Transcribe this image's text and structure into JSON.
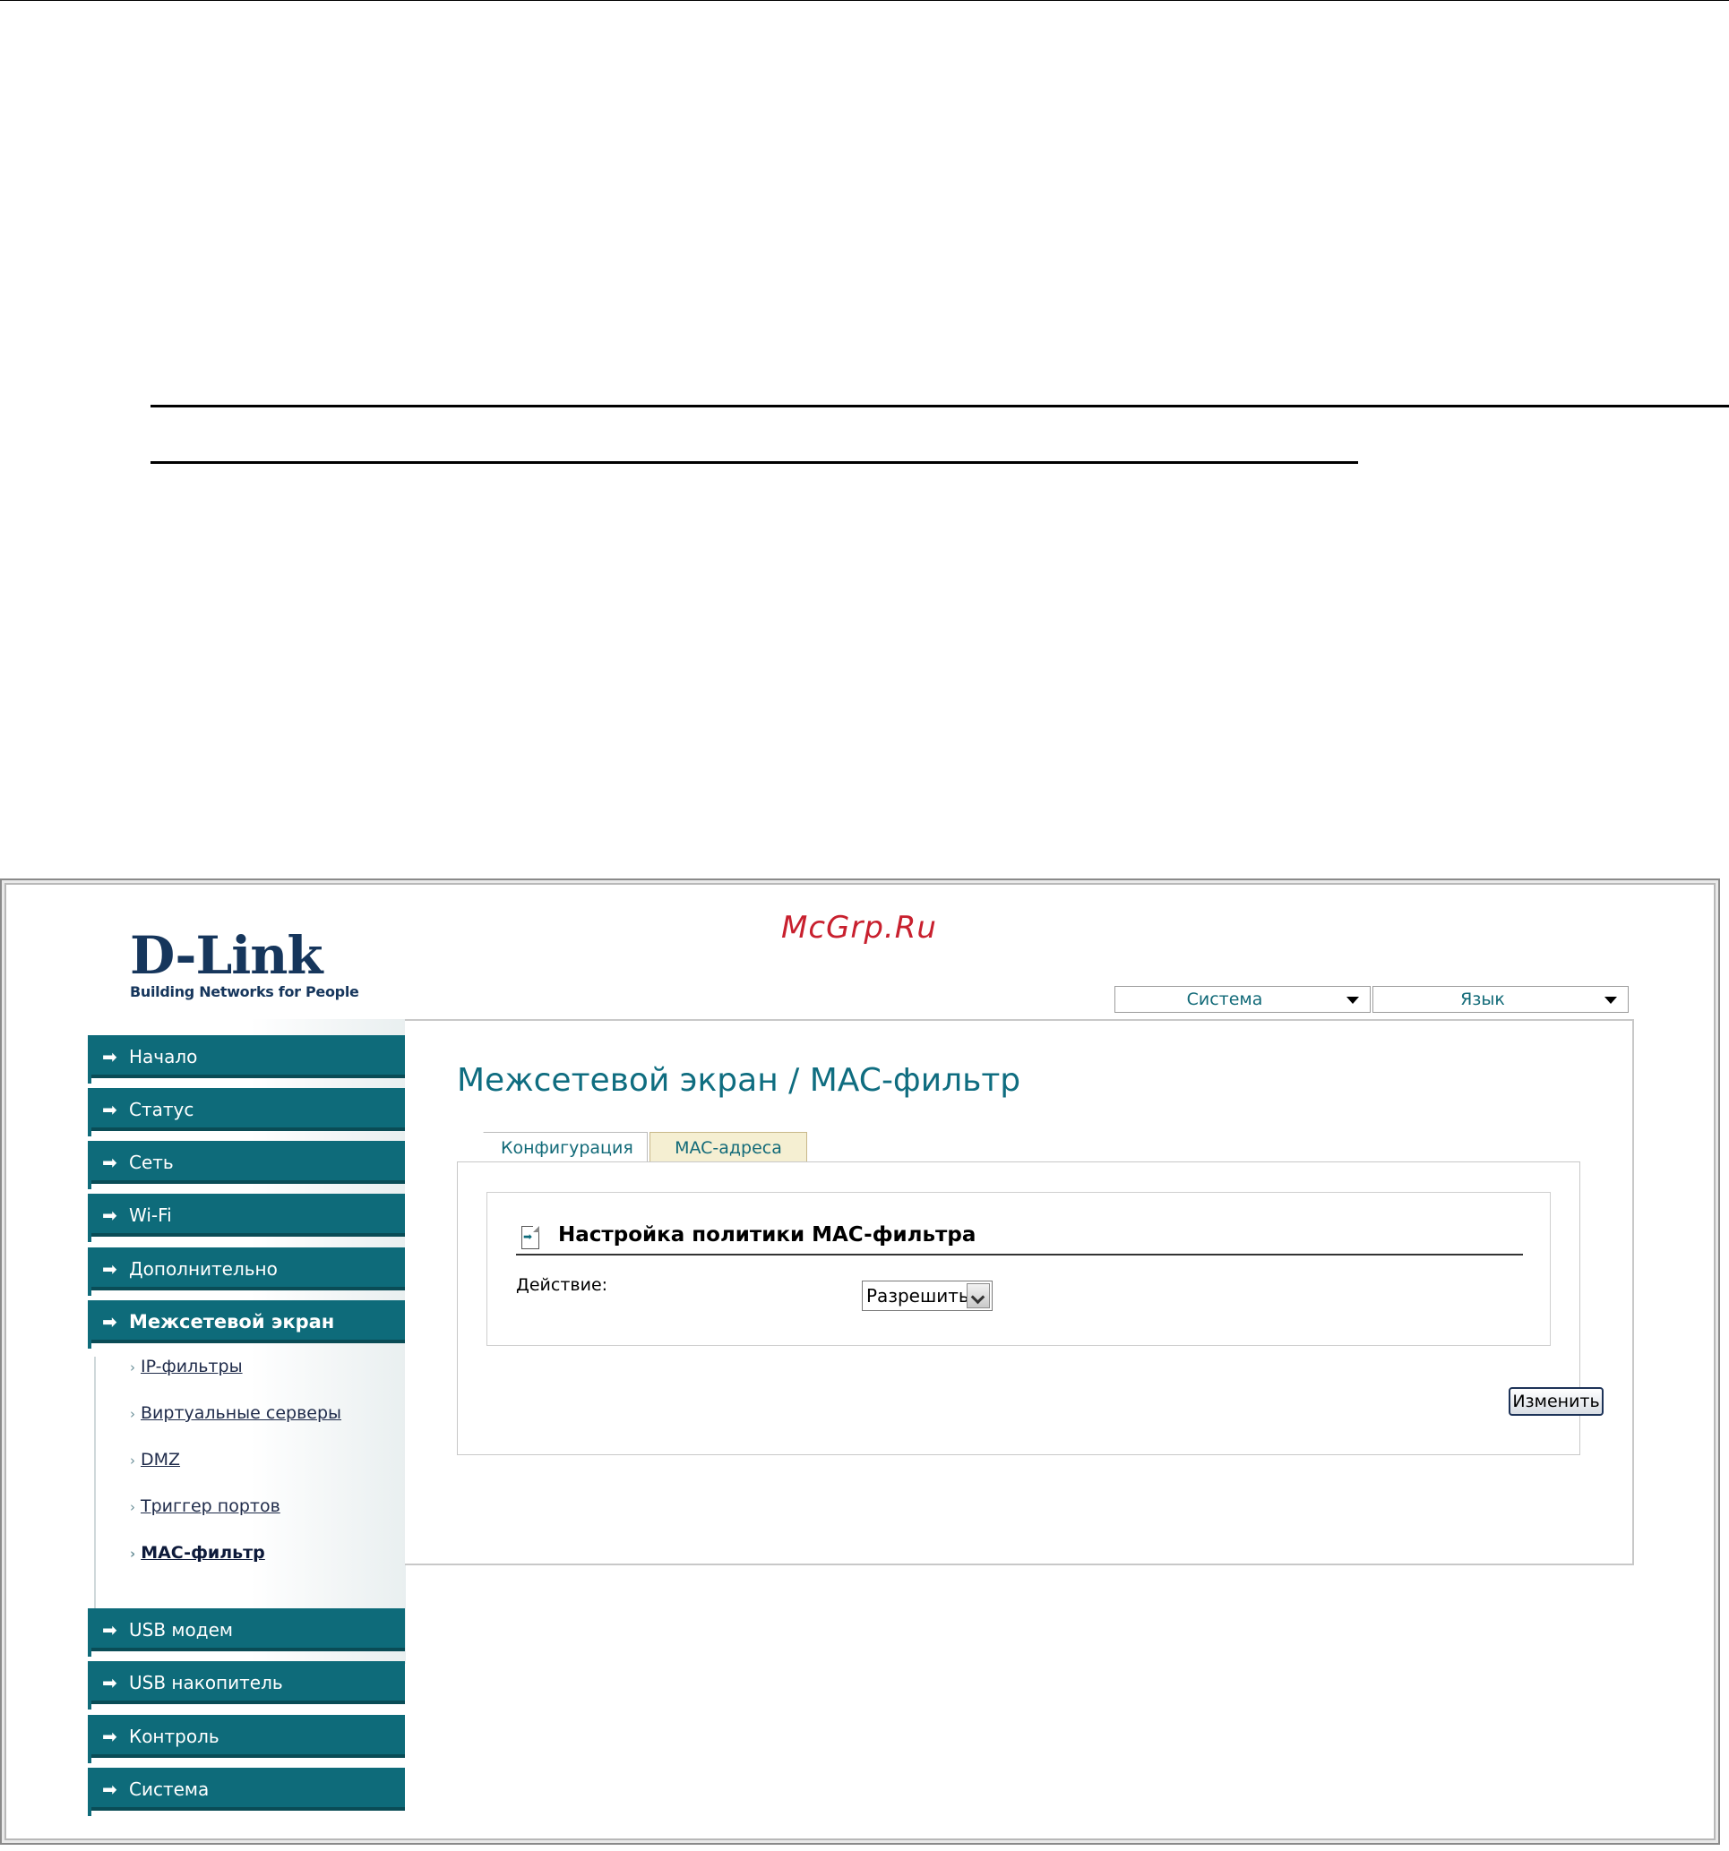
{
  "app": {
    "logo_text": "D-Link",
    "logo_tagline": "Building Networks for People",
    "watermark": "McGrp.Ru"
  },
  "top_menu": {
    "system_label": "Система",
    "language_label": "Язык"
  },
  "sidebar": {
    "items": [
      {
        "label": "Начало"
      },
      {
        "label": "Статус"
      },
      {
        "label": "Сеть"
      },
      {
        "label": "Wi-Fi"
      },
      {
        "label": "Дополнительно"
      },
      {
        "label": "Межсетевой экран",
        "active": true
      },
      {
        "label": "USB модем"
      },
      {
        "label": "USB накопитель"
      },
      {
        "label": "Контроль"
      },
      {
        "label": "Система"
      }
    ],
    "subitems": [
      {
        "label": "IP-фильтры"
      },
      {
        "label": "Виртуальные серверы"
      },
      {
        "label": "DMZ"
      },
      {
        "label": "Триггер портов"
      },
      {
        "label": "MAC-фильтр",
        "active": true
      }
    ]
  },
  "main": {
    "title": "Межсетевой экран /  MAC-фильтр",
    "tabs": [
      {
        "label": "Конфигурация",
        "active": true
      },
      {
        "label": "MAC-адреса"
      }
    ],
    "section": {
      "title": "Настройка политики MAC-фильтра",
      "action_label": "Действие:",
      "action_value": "Разрешить"
    },
    "change_button": "Изменить"
  },
  "colors": {
    "nav_bg": "#0e6b7a",
    "title": "#0f6d80",
    "watermark": "#c8202e",
    "logo": "#16365c"
  }
}
